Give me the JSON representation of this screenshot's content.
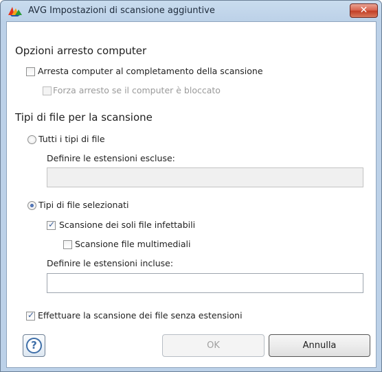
{
  "window": {
    "title": "AVG Impostazioni di scansione aggiuntive",
    "close_glyph": "✕"
  },
  "shutdown": {
    "section_title": "Opzioni arresto computer",
    "shutdown_checkbox": {
      "label": "Arresta computer al completamento della scansione",
      "checked": false
    },
    "force_checkbox": {
      "label": "Forza arresto se il computer è bloccato",
      "checked": false,
      "disabled": true
    }
  },
  "filetypes": {
    "section_title": "Tipi di file per la scansione",
    "all_types_radio": {
      "label": "Tutti i tipi di file",
      "selected": false
    },
    "excluded_label": "Definire le estensioni escluse:",
    "excluded_value": "",
    "selected_types_radio": {
      "label": "Tipi di file selezionati",
      "selected": true
    },
    "infectable_checkbox": {
      "label": "Scansione dei soli file infettabili",
      "checked": true
    },
    "media_checkbox": {
      "label": "Scansione file multimediali",
      "checked": false
    },
    "included_label": "Definire le estensioni incluse:",
    "included_value": "",
    "no_ext_checkbox": {
      "label": "Effettuare la scansione dei file senza estensioni",
      "checked": true
    }
  },
  "buttons": {
    "help": "?",
    "ok": "OK",
    "cancel": "Annulla"
  },
  "icons": {
    "app": "avg-logo-icon",
    "check": "✓"
  },
  "colors": {
    "title_bar": "#bcd1e8",
    "close_button": "#c23d24",
    "accent": "#3d6ea8"
  }
}
